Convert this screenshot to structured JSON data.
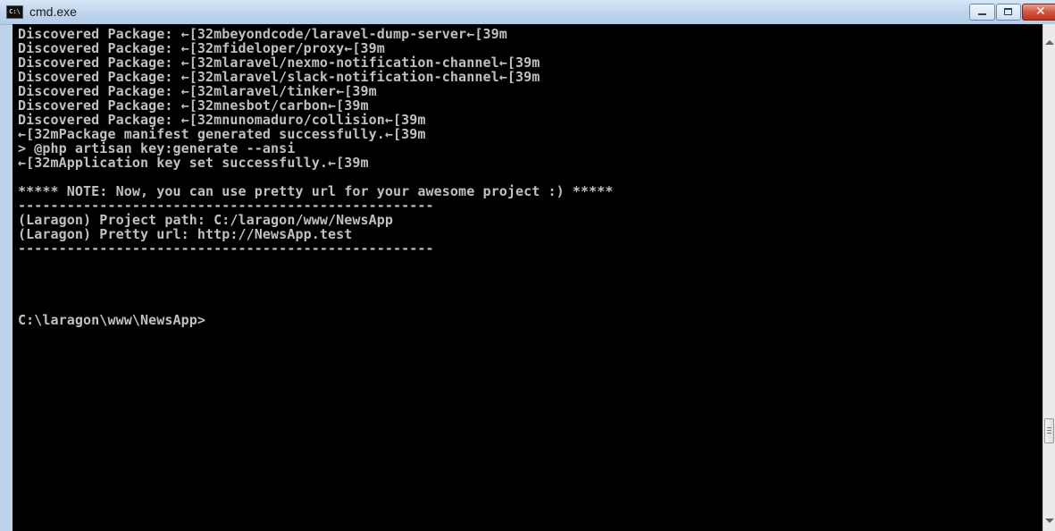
{
  "window": {
    "title": "cmd.exe",
    "icon": "cmd-icon",
    "icon_label": "C:\\",
    "close_glyph": "✕"
  },
  "console": {
    "lines": [
      "Discovered Package: ←[32mbeyondcode/laravel-dump-server←[39m",
      "Discovered Package: ←[32mfideloper/proxy←[39m",
      "Discovered Package: ←[32mlaravel/nexmo-notification-channel←[39m",
      "Discovered Package: ←[32mlaravel/slack-notification-channel←[39m",
      "Discovered Package: ←[32mlaravel/tinker←[39m",
      "Discovered Package: ←[32mnesbot/carbon←[39m",
      "Discovered Package: ←[32mnunomaduro/collision←[39m",
      "←[32mPackage manifest generated successfully.←[39m",
      "> @php artisan key:generate --ansi",
      "←[32mApplication key set successfully.←[39m",
      "",
      "***** NOTE: Now, you can use pretty url for your awesome project :) *****",
      "---------------------------------------------------",
      "(Laragon) Project path: C:/laragon/www/NewsApp",
      "(Laragon) Pretty url: http://NewsApp.test",
      "---------------------------------------------------",
      "",
      "",
      "",
      "",
      "C:\\laragon\\www\\NewsApp>"
    ]
  },
  "colors": {
    "console_background": "#000000",
    "console_text": "#c0c0c0"
  }
}
